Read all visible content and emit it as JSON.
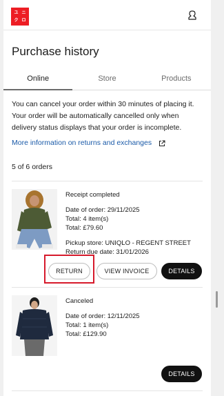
{
  "brand": {
    "logo_cells": [
      "ユ",
      "ニ",
      "ク",
      "ロ"
    ],
    "logo_cells_en": [
      "UNI",
      "QLO"
    ],
    "color": "#ed1d24"
  },
  "header": {
    "account_icon": "user-icon"
  },
  "page": {
    "title": "Purchase history"
  },
  "tabs": [
    {
      "label": "Online",
      "active": true
    },
    {
      "label": "Store",
      "active": false
    },
    {
      "label": "Products",
      "active": false
    }
  ],
  "notice": {
    "text": "You can cancel your order within 30 minutes of placing it. Your order will be automatically cancelled only when delivery status displays that your order is incomplete."
  },
  "links": {
    "returns_info": "More information on returns and exchanges",
    "external_icon": "external-link-icon"
  },
  "orders_count": "5 of 6 orders",
  "orders": [
    {
      "status": "Receipt completed",
      "date": "Date of order: 29/11/2025",
      "items": "Total: 4 item(s)",
      "total": "Total: £79.60",
      "pickup": "Pickup store: UNIQLO - REGENT STREET",
      "return_due": "Return due date: 31/01/2026",
      "buttons": {
        "return": "RETURN",
        "invoice": "VIEW INVOICE",
        "details": "DETAILS"
      }
    },
    {
      "status": "Canceled",
      "date": "Date of order: 12/11/2025",
      "items": "Total: 1 item(s)",
      "total": "Total: £129.90",
      "buttons": {
        "details": "DETAILS"
      }
    }
  ],
  "colors": {
    "accent_link": "#1a5aa8",
    "highlight": "#d6182a",
    "button_dark": "#111111"
  }
}
